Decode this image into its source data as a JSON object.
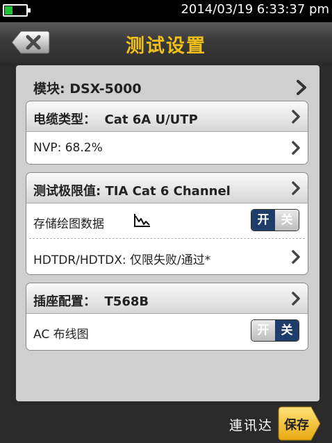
{
  "status_bar": {
    "datetime": "2014/03/19 6:33:37 pm",
    "battery_level": 0.4,
    "battery_color": "#22c236"
  },
  "header": {
    "title": "测试设置",
    "back_icon": "close-x-icon",
    "title_color": "#f0bf1c"
  },
  "module": {
    "label": "模块: DSX-5000"
  },
  "cable": {
    "header": "电缆类型：  Cat 6A U/UTP",
    "nvp": "NVP: 68.2%"
  },
  "limit": {
    "header": "测试极限值: TIA Cat 6 Channel",
    "store_plot": "存储绘图数据",
    "store_plot_icon": "plot-graph-icon",
    "hdtdr": "HDTDR/HDTDX: 仅限失败/通过*"
  },
  "toggles": {
    "on": "开",
    "off": "关",
    "store_plot_state": "on",
    "ac_wiremap_state": "off"
  },
  "outlet": {
    "header": "插座配置：  T568B",
    "ac_wiremap": "AC 布线图"
  },
  "footer": {
    "brand": "連讯达",
    "save": "保存",
    "save_color": "#f0bf1c"
  }
}
